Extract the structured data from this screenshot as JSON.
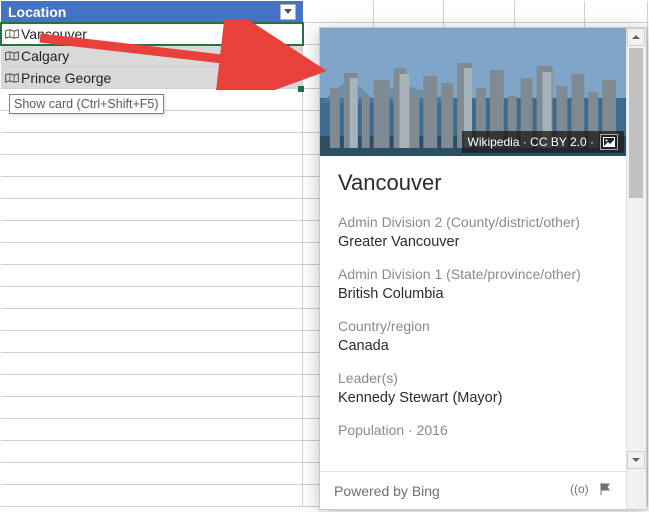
{
  "header": {
    "label": "Location"
  },
  "rows": {
    "r0": "Vancouver",
    "r1": "Calgary",
    "r2": "Prince George"
  },
  "tooltip": "Show card (Ctrl+Shift+F5)",
  "card": {
    "image_credit": "Wikipedia · CC BY 2.0 ·",
    "title": "Vancouver",
    "fields": {
      "f0": {
        "label": "Admin Division 2 (County/district/other)",
        "value": "Greater Vancouver"
      },
      "f1": {
        "label": "Admin Division 1 (State/province/other)",
        "value": "British Columbia"
      },
      "f2": {
        "label": "Country/region",
        "value": "Canada"
      },
      "f3": {
        "label": "Leader(s)",
        "value": "Kennedy Stewart (Mayor)"
      },
      "f4": {
        "label": "Population · 2016",
        "value": ""
      }
    },
    "footer": "Powered by Bing"
  }
}
